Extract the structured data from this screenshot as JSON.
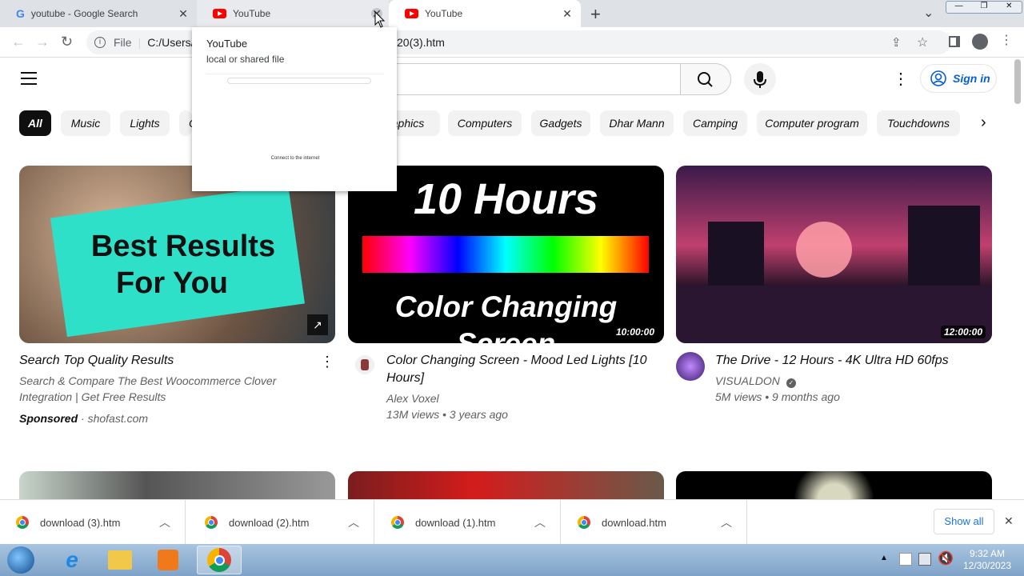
{
  "tabs": [
    {
      "title": "youtube - Google Search",
      "close": "✕"
    },
    {
      "title": "YouTube",
      "close": "✕"
    },
    {
      "title": "YouTube",
      "close": "✕"
    }
  ],
  "new_tab": "+",
  "tab_search": "⌄",
  "window_controls": {
    "min": "—",
    "max": "❐",
    "close": "✕"
  },
  "address": {
    "prefix": "File",
    "path_start": "C:/Users/V",
    "path_end": "20(3).htm"
  },
  "hovercard": {
    "title": "YouTube",
    "subtitle": "local or shared file",
    "mini_text": "Connect to the internet"
  },
  "yt": {
    "signin": "Sign in",
    "chips": [
      "All",
      "Music",
      "Lights",
      "C",
      "aphics",
      "Computers",
      "Gadgets",
      "Dhar Mann",
      "Camping",
      "Computer program",
      "Touchdowns"
    ]
  },
  "videos": [
    {
      "thumb_line1": "Best Results",
      "thumb_line2": "For You",
      "title": "Search Top Quality Results",
      "desc": "Search & Compare The Best Woocommerce Clover Integration | Get Free Results",
      "sponsored": "Sponsored",
      "domain": "· shofast.com"
    },
    {
      "thumb_top": "10 Hours",
      "thumb_bottom": "Color Changing Screen",
      "duration": "10:00:00",
      "title_line1": "Color Changing Screen - Mood Led Lights [10",
      "title_line2": "Hours]",
      "channel": "Alex Voxel",
      "meta": "13M views • 3 years ago"
    },
    {
      "duration": "12:00:00",
      "title": "The Drive - 12 Hours - 4K Ultra HD 60fps",
      "channel": "VISUALDON",
      "meta": "5M views • 9 months ago"
    }
  ],
  "downloads": [
    {
      "name": "download (3).htm"
    },
    {
      "name": "download (2).htm"
    },
    {
      "name": "download (1).htm"
    },
    {
      "name": "download.htm"
    }
  ],
  "show_all": "Show all",
  "clock": {
    "time": "9:32 AM",
    "date": "12/30/2023"
  },
  "colors": {
    "yt_red": "#ff0000",
    "signin_blue": "#065fd4",
    "taskbar": "#7ea3c8"
  }
}
